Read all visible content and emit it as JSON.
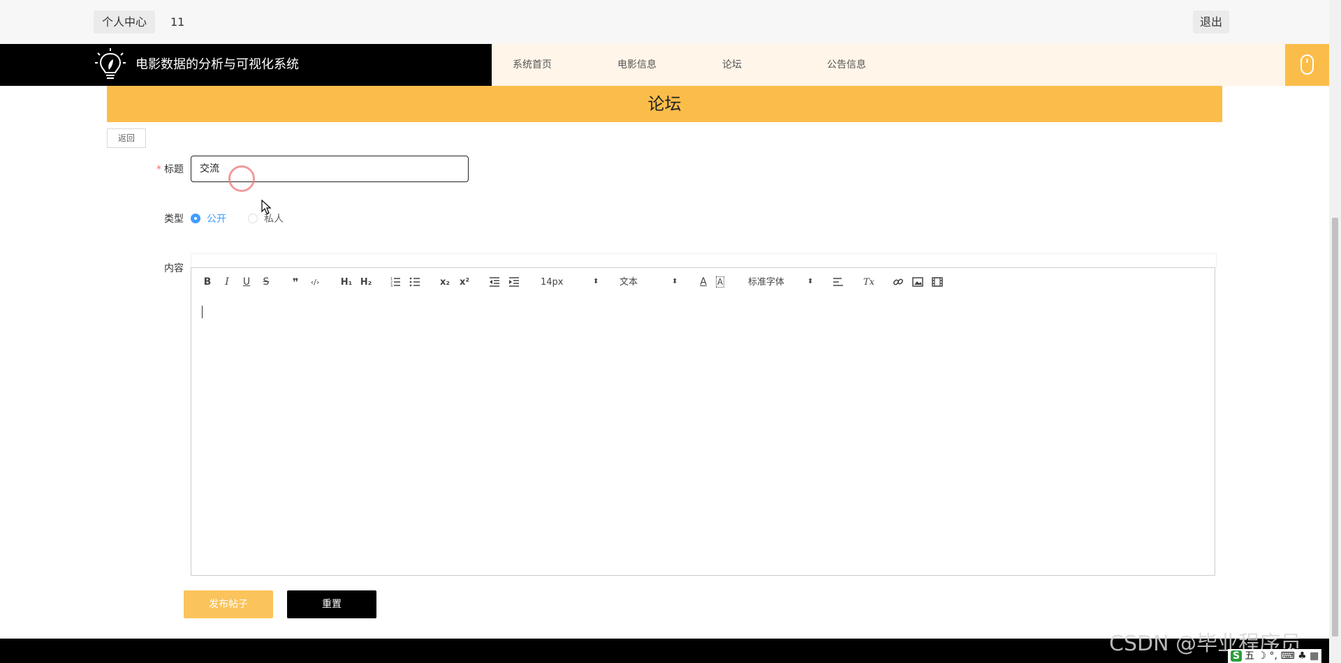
{
  "topbar": {
    "user_center": "个人中心",
    "username": "11",
    "logout": "退出"
  },
  "brand": {
    "title": "电影数据的分析与可视化系统"
  },
  "nav": {
    "items": [
      "系统首页",
      "电影信息",
      "论坛",
      "公告信息"
    ]
  },
  "page": {
    "title": "论坛",
    "back_label": "返回"
  },
  "form": {
    "title_label": "标题",
    "title_required_mark": "*",
    "title_value": "交流",
    "type_label": "类型",
    "type_options": [
      "公开",
      "私人"
    ],
    "type_selected": "公开",
    "content_label": "内容",
    "submit_label": "发布帖子",
    "reset_label": "重置"
  },
  "editor": {
    "font_size": "14px",
    "block_type": "文本",
    "font_family": "标准字体",
    "toolbar_icons": [
      "bold-icon",
      "italic-icon",
      "underline-icon",
      "strike-icon",
      "blockquote-icon",
      "code-block-icon",
      "h1-icon",
      "h2-icon",
      "ordered-list-icon",
      "bullet-list-icon",
      "subscript-icon",
      "superscript-icon",
      "outdent-icon",
      "indent-icon",
      "font-color-icon",
      "background-color-icon",
      "align-icon",
      "clear-format-icon",
      "link-icon",
      "image-icon",
      "video-icon"
    ],
    "glyphs": {
      "bold": "B",
      "italic": "I",
      "underline": "U",
      "strike": "S",
      "blockquote": "❞",
      "code": "‹/›",
      "h1": "H₁",
      "h2": "H₂",
      "sub": "x₂",
      "sup": "x²",
      "font_color": "A",
      "bg_color": "A",
      "clear": "Tx"
    }
  },
  "watermark": "CSDN @毕业程序员",
  "tray": {
    "ime": "S",
    "text": "五 ☽ °, ⌨ ♣ ▦"
  },
  "colors": {
    "accent": "#fbbd4a",
    "nav_bg": "#fff5e8",
    "brand_bg": "#000000",
    "radio_active": "#409eff"
  }
}
